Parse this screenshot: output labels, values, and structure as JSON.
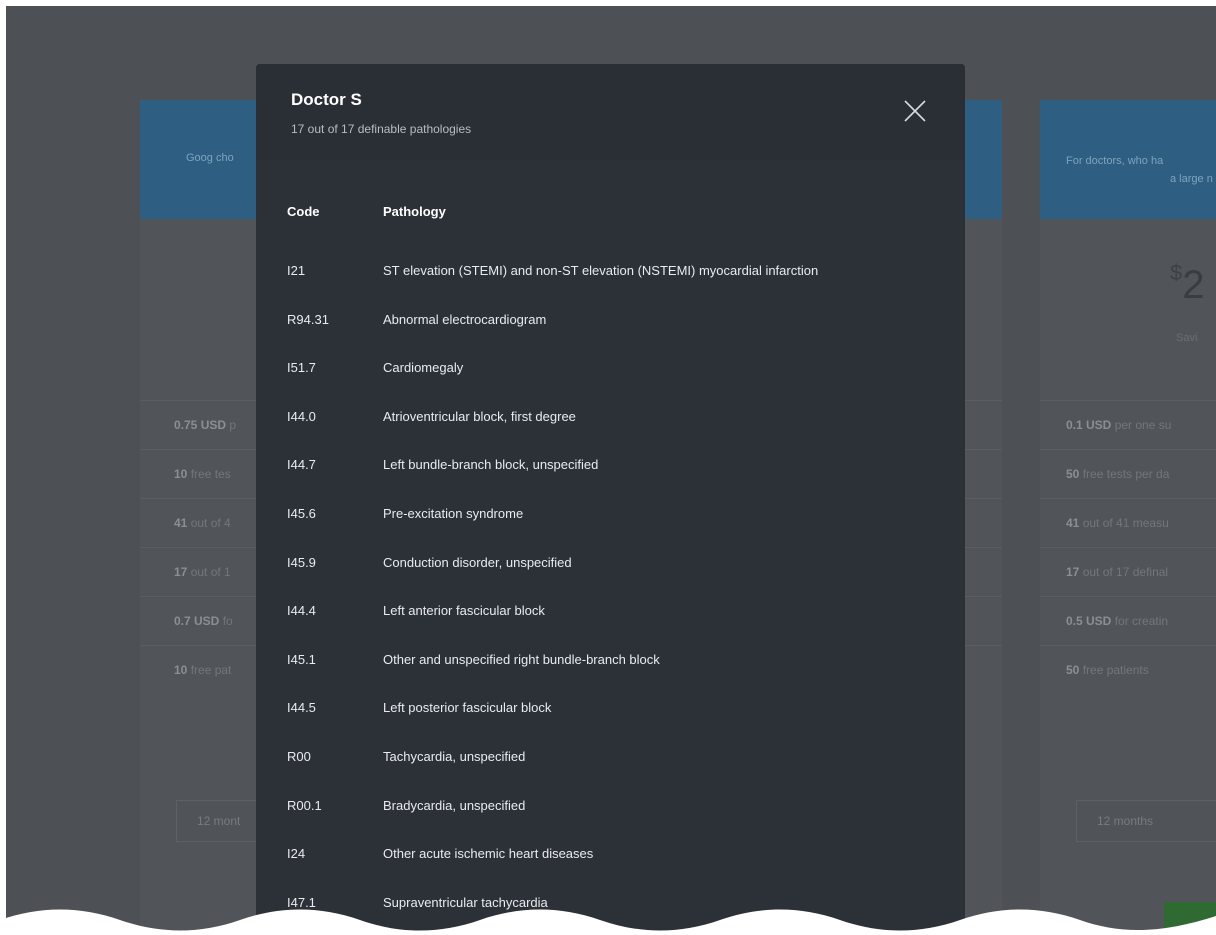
{
  "background": {
    "left_card": {
      "band_text": "Goog cho",
      "rows": [
        {
          "bold": "0.75 USD",
          "text": " p"
        },
        {
          "bold": "10",
          "text": " free tes"
        },
        {
          "bold": "41",
          "text": " out of 4"
        },
        {
          "bold": "17",
          "text": " out of 1"
        },
        {
          "bold": "0.7 USD",
          "text": " fo"
        },
        {
          "bold": "10",
          "text": " free pat"
        }
      ],
      "select_value": "12 mont"
    },
    "right_card": {
      "band_text_1": "For doctors, who ha",
      "band_text_2": "a large n",
      "price_currency": "$",
      "price_value": "2",
      "save_text": "Savi",
      "rows": [
        {
          "bold": "0.1 USD",
          "text": " per one su"
        },
        {
          "bold": "50",
          "text": " free tests per da"
        },
        {
          "bold": "41",
          "text": " out of 41 measu"
        },
        {
          "bold": "17",
          "text": " out of 17 definal"
        },
        {
          "bold": "0.5 USD",
          "text": " for creatin"
        },
        {
          "bold": "50",
          "text": " free patients"
        }
      ],
      "select_value": "12 months"
    }
  },
  "modal": {
    "title": "Doctor S",
    "subtitle": "17 out of 17 definable pathologies",
    "close_icon": "close-icon",
    "columns": {
      "code": "Code",
      "pathology": "Pathology"
    },
    "rows": [
      {
        "code": "I21",
        "pathology": "ST elevation (STEMI) and non-ST elevation (NSTEMI) myocardial infarction"
      },
      {
        "code": "R94.31",
        "pathology": "Abnormal electrocardiogram"
      },
      {
        "code": "I51.7",
        "pathology": "Cardiomegaly"
      },
      {
        "code": "I44.0",
        "pathology": "Atrioventricular block, first degree"
      },
      {
        "code": "I44.7",
        "pathology": "Left bundle-branch block, unspecified"
      },
      {
        "code": "I45.6",
        "pathology": "Pre-excitation syndrome"
      },
      {
        "code": "I45.9",
        "pathology": "Conduction disorder, unspecified"
      },
      {
        "code": "I44.4",
        "pathology": "Left anterior fascicular block"
      },
      {
        "code": "I45.1",
        "pathology": "Other and unspecified right bundle-branch block"
      },
      {
        "code": "I44.5",
        "pathology": "Left posterior fascicular block"
      },
      {
        "code": "R00",
        "pathology": "Tachycardia, unspecified"
      },
      {
        "code": "R00.1",
        "pathology": "Bradycardia, unspecified"
      },
      {
        "code": "I24",
        "pathology": "Other acute ischemic heart diseases"
      },
      {
        "code": "I47.1",
        "pathology": "Supraventricular tachycardia"
      }
    ]
  },
  "colors": {
    "overlay": "#4d5054",
    "modal_bg": "#2c3138",
    "band_blue": "#2e5f82",
    "text_white": "#ffffff"
  }
}
